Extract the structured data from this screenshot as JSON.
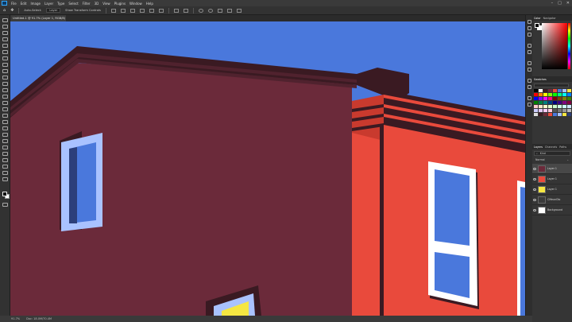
{
  "menu": {
    "items": [
      "File",
      "Edit",
      "Image",
      "Layer",
      "Type",
      "Select",
      "Filter",
      "3D",
      "View",
      "Plugins",
      "Window",
      "Help"
    ]
  },
  "options": {
    "auto_select_label": "Auto-Select:",
    "auto_select_value": "Layer",
    "transform_label": "Show Transform Controls"
  },
  "document": {
    "tab_title": "Untitled-1 @ 91.7% (Layer 1, RGB/8) *"
  },
  "status": {
    "zoom": "91.7%",
    "doc_size": "Doc: 18.0M/70.4M"
  },
  "panels": {
    "top_tabs": [
      "Color",
      "Navigator"
    ],
    "swatches_tab": "Swatches",
    "layer_tabs": [
      "Layers",
      "Channels",
      "Paths"
    ],
    "kind_label": "Kind",
    "blend_mode": "Normal",
    "layers": [
      {
        "name": "Layer 1",
        "selected": true,
        "thumb_color": "#6b2a3a"
      },
      {
        "name": "Layer 1",
        "selected": false,
        "thumb_color": "#e94a3c"
      },
      {
        "name": "Layer 1",
        "selected": false,
        "thumb_color": "#f5e642"
      },
      {
        "name": "CMeunOlo",
        "selected": false,
        "thumb_color": "#3a3a3a"
      },
      {
        "name": "Background",
        "selected": false,
        "thumb_color": "#ffffff"
      }
    ]
  },
  "colors": {
    "sky": "#4a78dc",
    "building_left": "#6b2a3a",
    "building_right": "#e94a3c",
    "shadow": "#3a1a22",
    "window_frame": "#a9c2ff",
    "window_glass": "#4a78dc",
    "window_yellow": "#f5e642",
    "white_frame": "#ffffff"
  }
}
